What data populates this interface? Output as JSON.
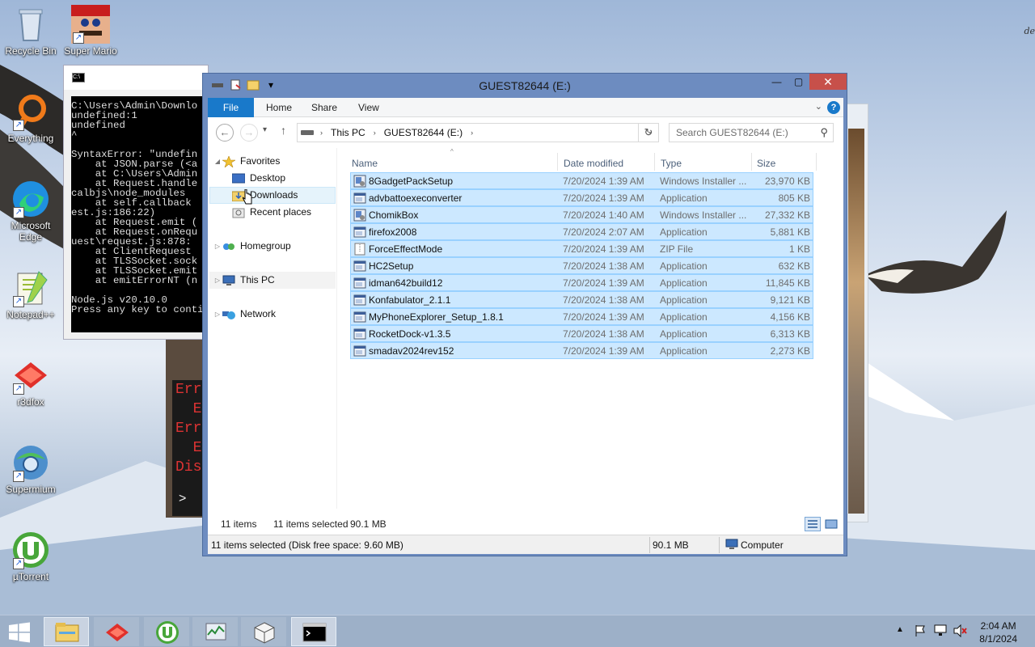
{
  "desktop": {
    "corner_text": "de",
    "icons": [
      {
        "label": "Recycle Bin",
        "icon": "recycle-bin-icon"
      },
      {
        "label": "Super Mario",
        "icon": "mario-icon"
      },
      {
        "label": "Everything",
        "icon": "everything-icon"
      },
      {
        "label": "Microsoft Edge",
        "icon": "edge-icon"
      },
      {
        "label": "Notepad++",
        "icon": "notepadpp-icon"
      },
      {
        "label": "r3dfox",
        "icon": "r3dfox-icon"
      },
      {
        "label": "Supermium",
        "icon": "supermium-icon"
      },
      {
        "label": "µTorrent",
        "icon": "utorrent-icon"
      }
    ]
  },
  "console": {
    "lines": "C:\\Users\\Admin\\Downlo\nundefined:1\nundefined\n^\n\nSyntaxError: \"undefin\n    at JSON.parse (<a\n    at C:\\Users\\Admin\n    at Request.handle\ncalbjs\\node_modules\n    at self.callback\nest.js:186:22)\n    at Request.emit (\n    at Request.onRequ\nuest\\request.js:878:\n    at ClientRequest\n    at TLSSocket.sock\n    at TLSSocket.emit\n    at emitErrorNT (n\n\nNode.js v20.10.0\nPress any key to conti"
  },
  "term2": {
    "lines": "Err\n  E\nErr\n  E\nDis",
    "prompt": ">"
  },
  "explorer": {
    "title": "GUEST82644 (E:)",
    "ribbon_tabs": [
      "File",
      "Home",
      "Share",
      "View"
    ],
    "breadcrumb": [
      "This PC",
      "GUEST82644 (E:)"
    ],
    "search_placeholder": "Search GUEST82644 (E:)",
    "nav": {
      "favorites": "Favorites",
      "desktop": "Desktop",
      "downloads": "Downloads",
      "recent": "Recent places",
      "homegroup": "Homegroup",
      "thispc": "This PC",
      "network": "Network"
    },
    "columns": {
      "name": "Name",
      "date": "Date modified",
      "type": "Type",
      "size": "Size"
    },
    "files": [
      {
        "name": "8GadgetPackSetup",
        "date": "7/20/2024 1:39 AM",
        "type": "Windows Installer ...",
        "size": "23,970 KB",
        "icon": "installer-icon"
      },
      {
        "name": "advbattoexeconverter",
        "date": "7/20/2024 1:39 AM",
        "type": "Application",
        "size": "805 KB",
        "icon": "app-icon"
      },
      {
        "name": "ChomikBox",
        "date": "7/20/2024 1:40 AM",
        "type": "Windows Installer ...",
        "size": "27,332 KB",
        "icon": "installer-icon"
      },
      {
        "name": "firefox2008",
        "date": "7/20/2024 2:07 AM",
        "type": "Application",
        "size": "5,881 KB",
        "icon": "app-icon"
      },
      {
        "name": "ForceEffectMode",
        "date": "7/20/2024 1:39 AM",
        "type": "ZIP File",
        "size": "1 KB",
        "icon": "zip-icon"
      },
      {
        "name": "HC2Setup",
        "date": "7/20/2024 1:38 AM",
        "type": "Application",
        "size": "632 KB",
        "icon": "app-icon"
      },
      {
        "name": "idman642build12",
        "date": "7/20/2024 1:39 AM",
        "type": "Application",
        "size": "11,845 KB",
        "icon": "app-icon"
      },
      {
        "name": "Konfabulator_2.1.1",
        "date": "7/20/2024 1:38 AM",
        "type": "Application",
        "size": "9,121 KB",
        "icon": "app-icon"
      },
      {
        "name": "MyPhoneExplorer_Setup_1.8.1",
        "date": "7/20/2024 1:39 AM",
        "type": "Application",
        "size": "4,156 KB",
        "icon": "app-icon"
      },
      {
        "name": "RocketDock-v1.3.5",
        "date": "7/20/2024 1:38 AM",
        "type": "Application",
        "size": "6,313 KB",
        "icon": "app-icon"
      },
      {
        "name": "smadav2024rev152",
        "date": "7/20/2024 1:39 AM",
        "type": "Application",
        "size": "2,273 KB",
        "icon": "app-icon"
      }
    ],
    "status": {
      "items": "11 items",
      "selected": "11 items selected",
      "selected_size": "90.1 MB",
      "bottom_left": "11 items selected (Disk free space: 9.60 MB)",
      "bottom_size": "90.1 MB",
      "bottom_location": "Computer"
    }
  },
  "taskbar": {
    "apps": [
      "file-explorer",
      "r3dfox",
      "utorrent",
      "task-manager",
      "box-app",
      "command-prompt"
    ],
    "time": "2:04 AM",
    "date": "8/1/2024"
  },
  "colors": {
    "selection": "#cce8ff",
    "file_tab": "#1979ca",
    "title_bar": "#6d8cc0",
    "close": "#c7504a"
  }
}
